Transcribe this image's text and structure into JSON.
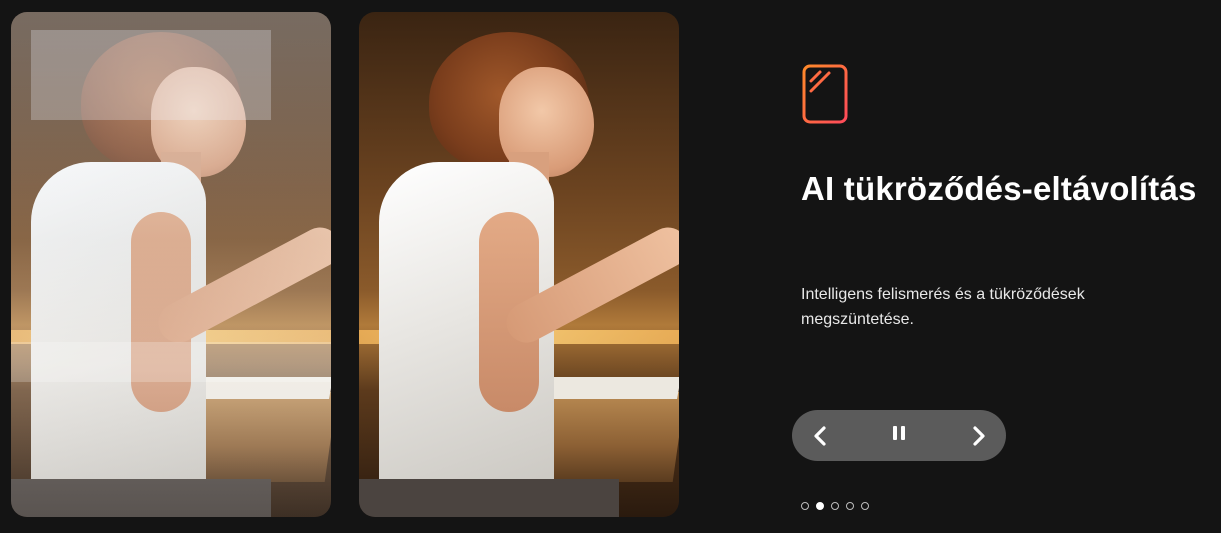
{
  "images": [
    {
      "name": "before-image",
      "state": "with-reflection"
    },
    {
      "name": "after-image",
      "state": "reflection-removed"
    }
  ],
  "feature": {
    "icon": "reflection-glass-icon",
    "icon_colors": [
      "#ff7a2e",
      "#ff4a5a"
    ],
    "title": "AI tükröződés-eltávolítás",
    "description": "Intelligens felismerés és a tükröződések megszüntetése."
  },
  "controls": {
    "prev_icon": "chevron-left-icon",
    "pause_icon": "pause-icon",
    "next_icon": "chevron-right-icon"
  },
  "pagination": {
    "total": 5,
    "active_index": 1
  },
  "colors": {
    "background": "#141414",
    "control_bg": "#5b5b5b",
    "text": "#ffffff"
  }
}
